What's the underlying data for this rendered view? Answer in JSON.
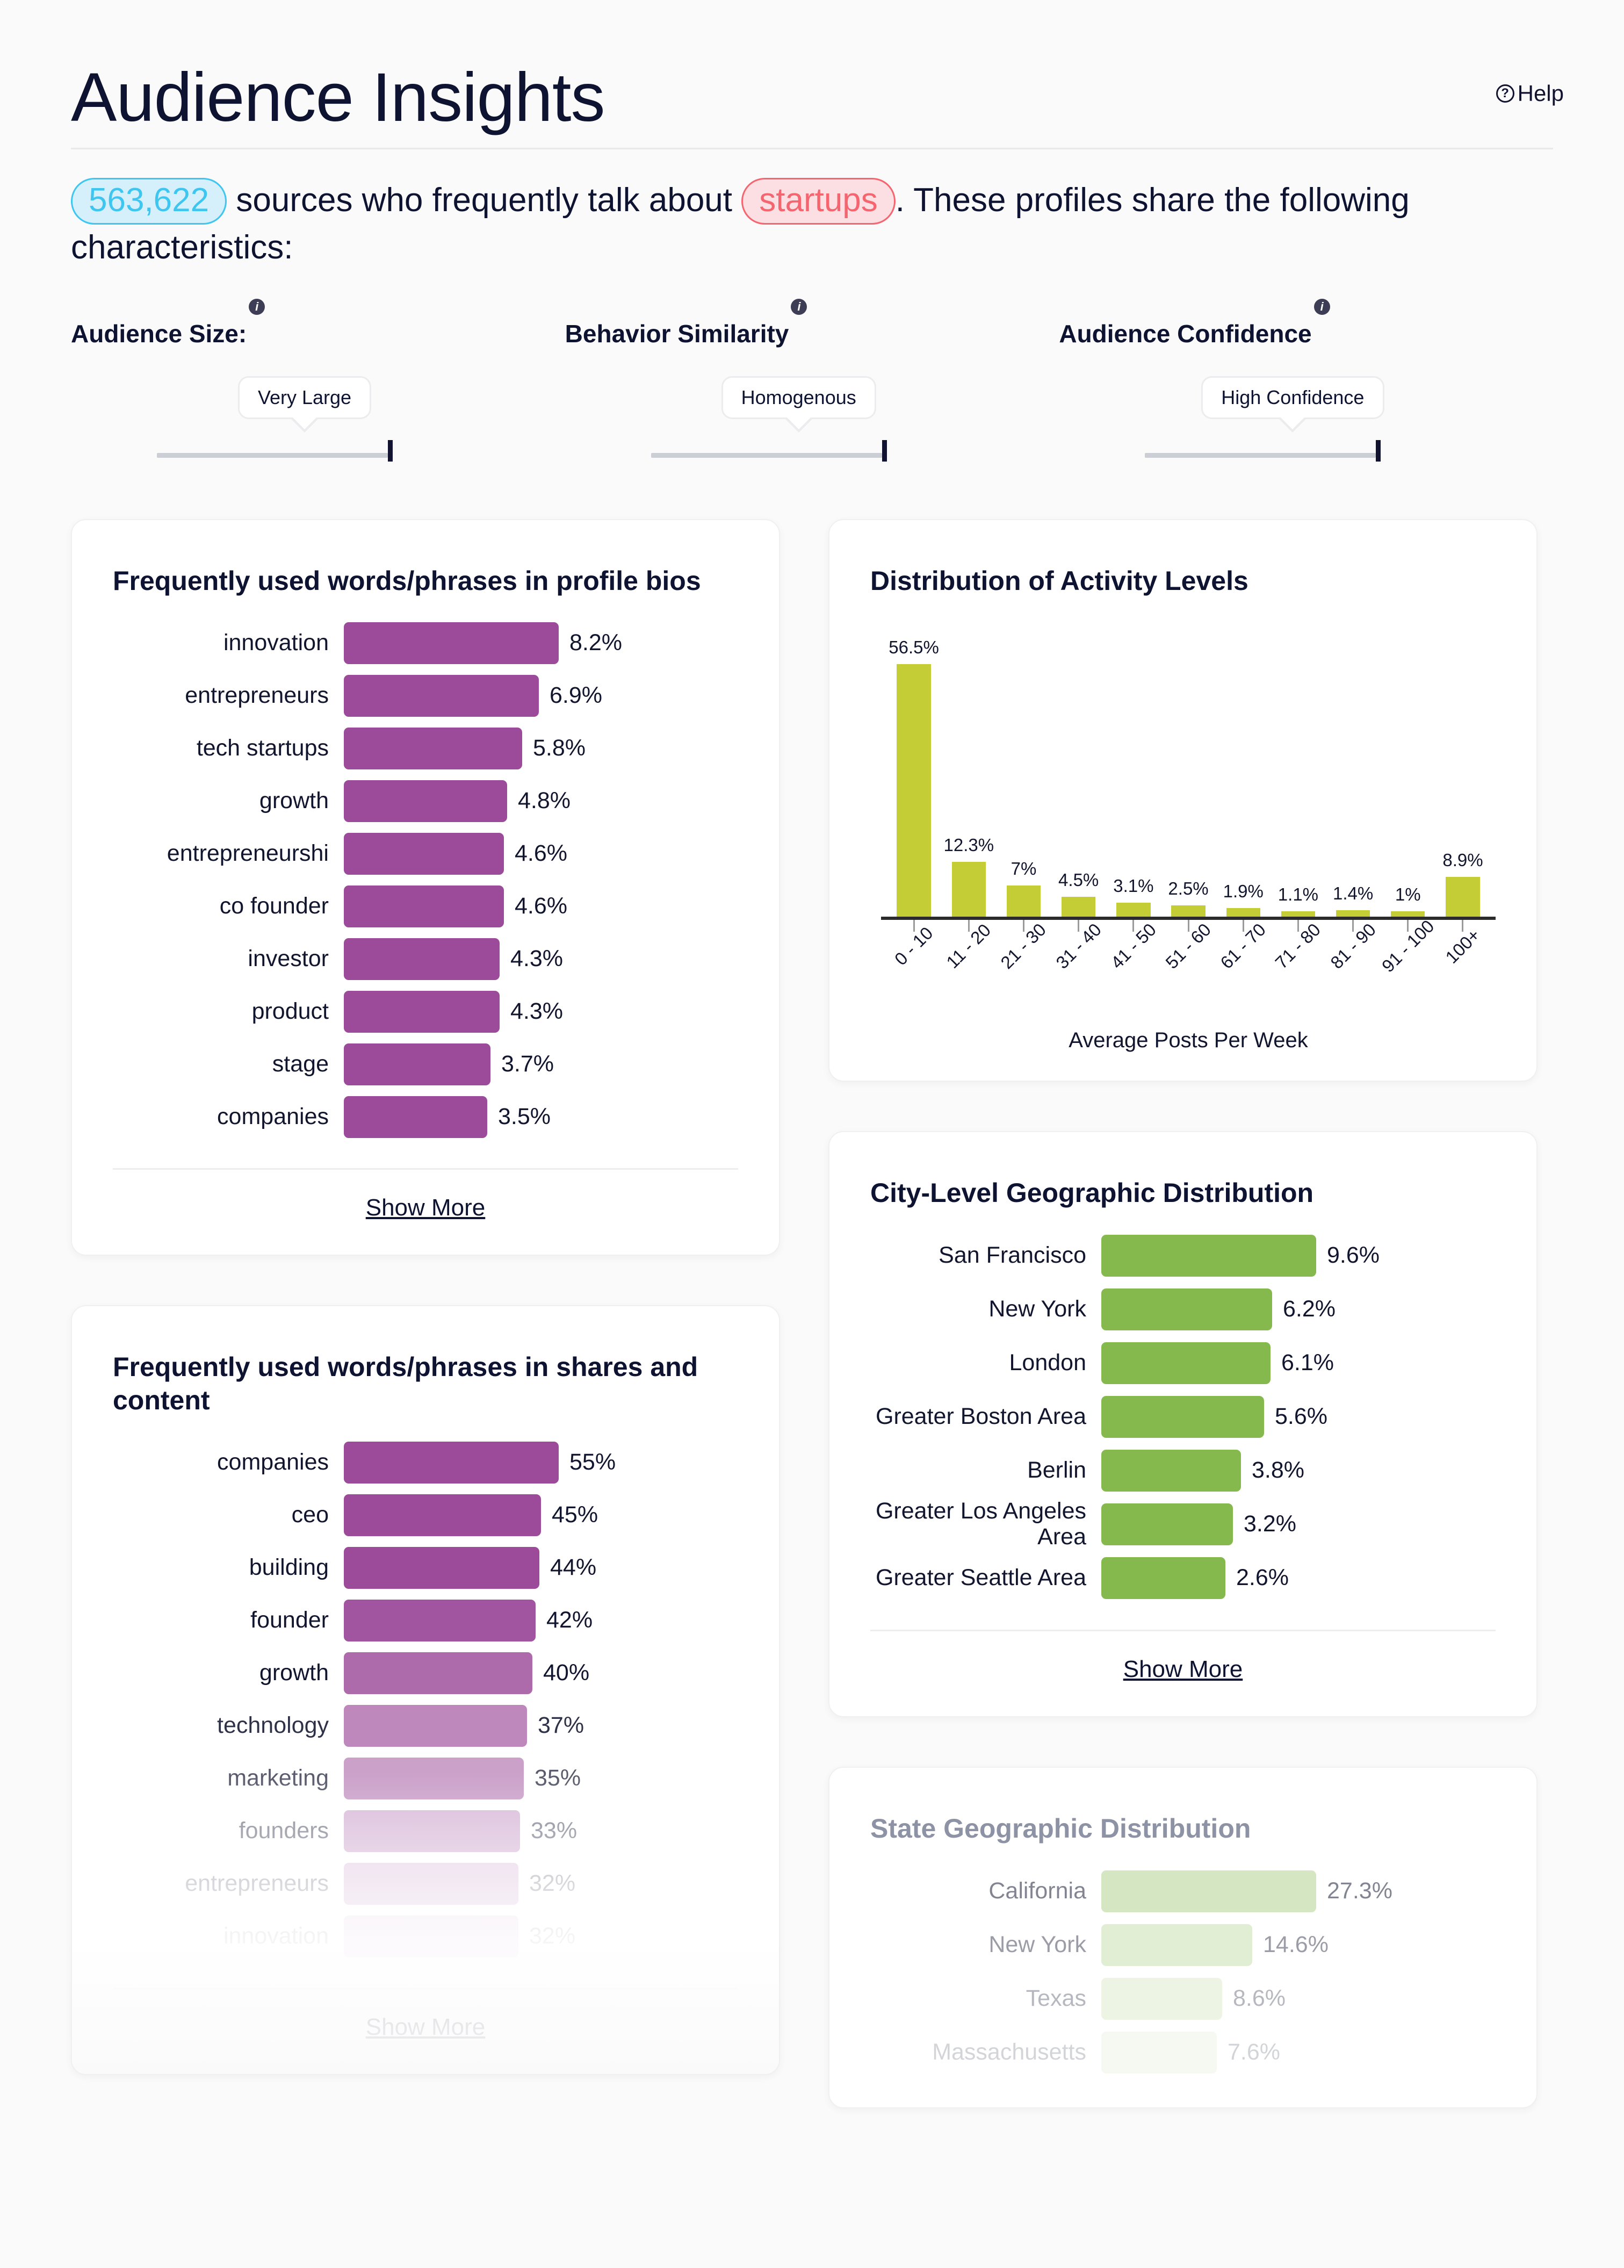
{
  "header": {
    "title": "Audience Insights",
    "help_label": "Help",
    "help_icon": "question-circle-icon",
    "summary_count": "563,622",
    "summary_mid": "sources who frequently talk about",
    "summary_topic": "startups",
    "summary_tail": ". These profiles share the following characteristics:"
  },
  "metrics": [
    {
      "label": "Audience Size:",
      "value": "Very Large",
      "info_icon": "info-icon"
    },
    {
      "label": "Behavior Similarity",
      "value": "Homogenous",
      "info_icon": "info-icon"
    },
    {
      "label": "Audience Confidence",
      "value": "High Confidence",
      "info_icon": "info-icon"
    }
  ],
  "colors": {
    "purple": "#9c4b9a",
    "green": "#85b84d",
    "olive": "#c4cc36",
    "accent_blue": "#3ec6f0",
    "accent_red": "#f4656f",
    "ink": "#121331"
  },
  "cards": {
    "bios": {
      "title": "Frequently used words/phrases in profile bios",
      "show_more": "Show More"
    },
    "shares": {
      "title": "Frequently used words/phrases in shares and content",
      "show_more": "Show More"
    },
    "activity": {
      "title": "Distribution of Activity Levels"
    },
    "city": {
      "title": "City-Level Geographic Distribution",
      "show_more": "Show More"
    },
    "state": {
      "title": "State Geographic Distribution"
    }
  },
  "chart_data": [
    {
      "type": "bar",
      "orientation": "horizontal",
      "id": "profile-bios",
      "title": "Frequently used words/phrases in profile bios",
      "xlabel": "",
      "ylabel": "",
      "categories": [
        "innovation",
        "entrepreneurs",
        "tech startups",
        "growth",
        "entrepreneurshi",
        "co founder",
        "investor",
        "product",
        "stage",
        "companies"
      ],
      "values": [
        8.2,
        6.9,
        5.8,
        4.8,
        4.6,
        4.6,
        4.3,
        4.3,
        3.7,
        3.5
      ],
      "labels": [
        "8.2%",
        "6.9%",
        "5.8%",
        "4.8%",
        "4.6%",
        "4.6%",
        "4.3%",
        "4.3%",
        "3.7%",
        "3.5%"
      ],
      "color": "#9c4b9a",
      "xlim": [
        0,
        8.2
      ]
    },
    {
      "type": "bar",
      "orientation": "vertical",
      "id": "activity-levels",
      "title": "Distribution of Activity Levels",
      "xlabel": "Average Posts Per Week",
      "ylabel": "",
      "categories": [
        "0 - 10",
        "11 - 20",
        "21 - 30",
        "31 - 40",
        "41 - 50",
        "51 - 60",
        "61 - 70",
        "71 - 80",
        "81 - 90",
        "91 - 100",
        "100+"
      ],
      "values": [
        56.5,
        12.3,
        7,
        4.5,
        3.1,
        2.5,
        1.9,
        1.1,
        1.4,
        1,
        8.9
      ],
      "labels": [
        "56.5%",
        "12.3%",
        "7%",
        "4.5%",
        "3.1%",
        "2.5%",
        "1.9%",
        "1.1%",
        "1.4%",
        "1%",
        "8.9%"
      ],
      "color": "#c4cc36",
      "ylim": [
        0,
        56.5
      ],
      "grid": false
    },
    {
      "type": "bar",
      "orientation": "horizontal",
      "id": "city-geo",
      "title": "City-Level Geographic Distribution",
      "xlabel": "",
      "ylabel": "",
      "categories": [
        "San Francisco",
        "New York",
        "London",
        "Greater Boston Area",
        "Berlin",
        "Greater Los Angeles Area",
        "Greater Seattle Area"
      ],
      "values": [
        9.6,
        6.2,
        6.1,
        5.6,
        3.8,
        3.2,
        2.6
      ],
      "labels": [
        "9.6%",
        "6.2%",
        "6.1%",
        "5.6%",
        "3.8%",
        "3.2%",
        "2.6%"
      ],
      "color": "#85b84d",
      "xlim": [
        0,
        9.6
      ]
    },
    {
      "type": "bar",
      "orientation": "horizontal",
      "id": "shares-content",
      "title": "Frequently used words/phrases in shares and content",
      "xlabel": "",
      "ylabel": "",
      "categories": [
        "companies",
        "ceo",
        "building",
        "founder",
        "growth",
        "technology",
        "marketing",
        "founders",
        "entrepreneurs",
        "innovation"
      ],
      "values": [
        55,
        45,
        44,
        42,
        40,
        37,
        35,
        33,
        32,
        32
      ],
      "labels": [
        "55%",
        "45%",
        "44%",
        "42%",
        "40%",
        "37%",
        "35%",
        "33%",
        "32%",
        "32%"
      ],
      "color": "#9c4b9a",
      "xlim": [
        0,
        55
      ]
    },
    {
      "type": "bar",
      "orientation": "horizontal",
      "id": "state-geo",
      "title": "State Geographic Distribution",
      "xlabel": "",
      "ylabel": "",
      "categories": [
        "California",
        "New York",
        "Texas",
        "Massachusetts"
      ],
      "values": [
        27.3,
        14.6,
        8.6,
        7.6
      ],
      "labels": [
        "27.3%",
        "14.6%",
        "8.6%",
        "7.6%"
      ],
      "color": "#85b84d",
      "xlim": [
        0,
        27.3
      ]
    }
  ]
}
